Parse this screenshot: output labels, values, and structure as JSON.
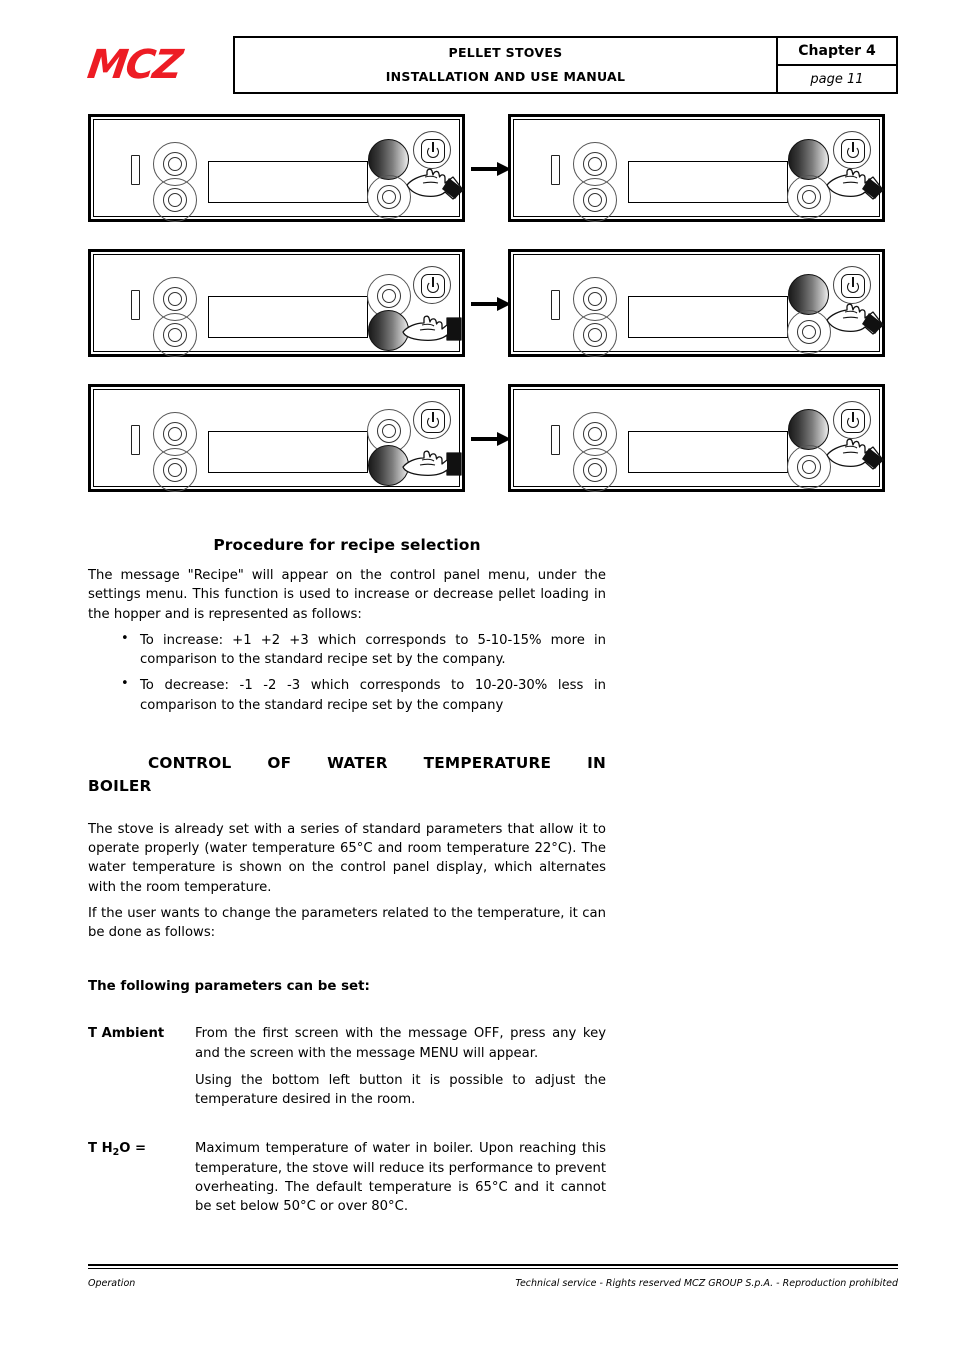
{
  "header": {
    "logo_text": "MCZ",
    "title_line1": "PELLET STOVES",
    "title_line2": "INSTALLATION AND USE MANUAL",
    "chapter": "Chapter 4",
    "page": "page 11"
  },
  "diagrams": {
    "arrow_icon": "right-arrow-icon",
    "rows": [
      {
        "left": {
          "knob_position": "top",
          "hand_target": "top-knob"
        },
        "right": {
          "knob_position": "top",
          "hand_target": "top-knob"
        }
      },
      {
        "left": {
          "knob_position": "bottom",
          "hand_target": "bottom-knob"
        },
        "right": {
          "knob_position": "top",
          "hand_target": "top-knob"
        }
      },
      {
        "left": {
          "knob_position": "bottom",
          "hand_target": "bottom-knob"
        },
        "right": {
          "knob_position": "top",
          "hand_target": "top-knob"
        }
      }
    ]
  },
  "recipe_section": {
    "heading": "Procedure for recipe selection",
    "intro": "The message \"Recipe\" will appear on the control panel menu, under the settings menu. This function is used to increase or decrease pellet loading in the hopper and is represented as follows:",
    "bullets": [
      "To increase: +1 +2 +3 which corresponds to 5-10-15% more in comparison to the standard recipe set by the company.",
      "To decrease: -1 -2 -3 which corresponds to 10-20-30% less in comparison to the standard recipe set by the company"
    ]
  },
  "boiler_section": {
    "heading_words": [
      "CONTROL",
      "OF",
      "WATER",
      "TEMPERATURE",
      "IN"
    ],
    "heading_line2": "BOILER",
    "paragraph1": "The stove is already set with a series of standard parameters that allow it to operate properly (water temperature 65°C and room temperature 22°C). The water temperature is shown on the control panel display, which alternates with the room temperature.",
    "paragraph2": "If the user wants to change the parameters related to the temperature, it can be done as follows:",
    "params_intro": "The following parameters can be set:",
    "params": [
      {
        "term": "T Ambient",
        "term_sub": "",
        "term_suffix": "",
        "lines": [
          "From the first screen with the message OFF, press any key and the screen with the message MENU will appear.",
          "Using the bottom left button it is possible to adjust the temperature desired in the room."
        ]
      },
      {
        "term": "T H",
        "term_sub": "2",
        "term_suffix": "O =",
        "lines": [
          "Maximum temperature of water in boiler. Upon reaching this temperature, the stove will reduce its performance to prevent overheating. The default temperature is 65°C and it cannot be set below 50°C or over 80°C."
        ]
      }
    ]
  },
  "footer": {
    "left": "Operation",
    "right": "Technical service - Rights reserved MCZ GROUP S.p.A. - Reproduction prohibited"
  },
  "colors": {
    "brand_red": "#ED1C24",
    "ink": "#000000"
  }
}
